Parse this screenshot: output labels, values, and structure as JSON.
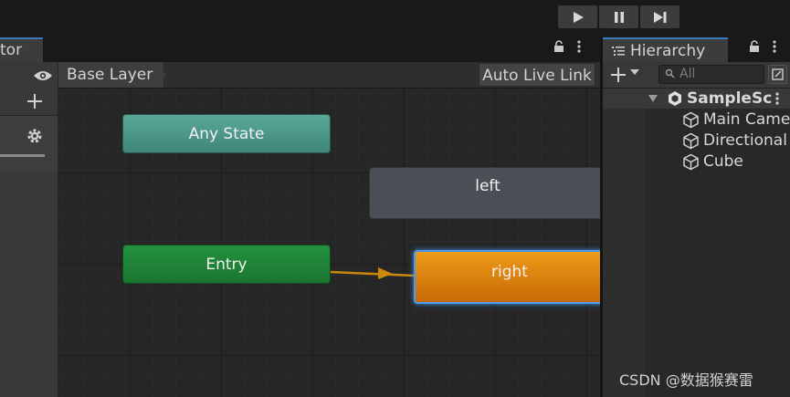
{
  "play_toolbar": {
    "buttons": [
      {
        "icon": "play-icon"
      },
      {
        "icon": "pause-icon"
      },
      {
        "icon": "step-icon"
      }
    ]
  },
  "animator": {
    "tab_label": "tor",
    "breadcrumb": "Base Layer",
    "auto_live_link": "Auto Live Link",
    "nodes": {
      "any_state": "Any State",
      "left": "left",
      "entry": "Entry",
      "right": "right"
    },
    "colors": {
      "any_state": "#4a988c",
      "entry": "#1f8737",
      "default_state": "#ee9a1a",
      "state": "#4b4f55",
      "selection": "#4c9bf0",
      "transition": "#c98a0c"
    }
  },
  "hierarchy": {
    "tab_label": "Hierarchy",
    "search_placeholder": "All",
    "scene": "SampleSc",
    "items": [
      {
        "label": "Main Came"
      },
      {
        "label": "Directional"
      },
      {
        "label": "Cube"
      }
    ]
  },
  "watermark": "CSDN @数据猴赛雷"
}
